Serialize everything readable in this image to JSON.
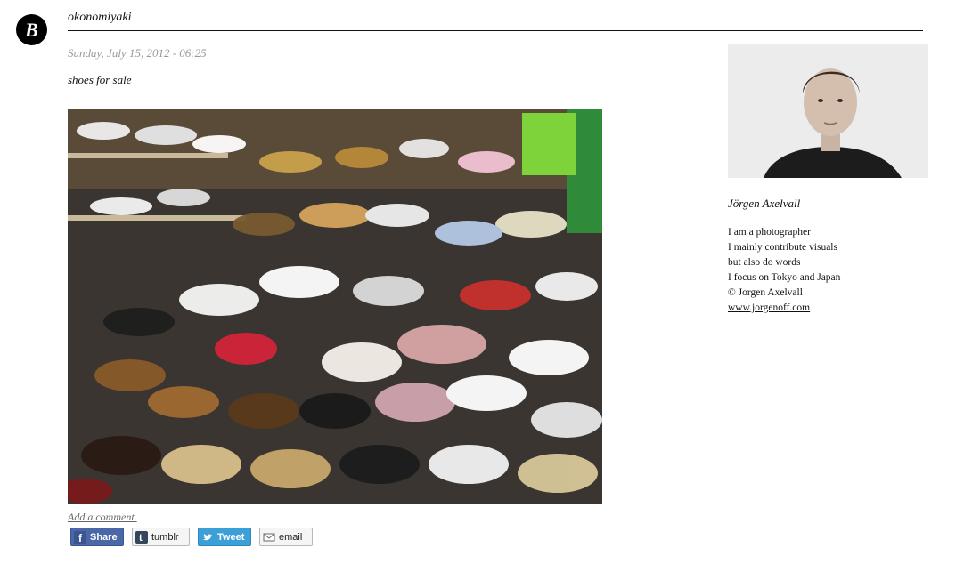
{
  "header": {
    "logo_letter": "B",
    "blog_title": "okonomiyaki"
  },
  "post": {
    "date": "Sunday, July 15, 2012 - 06:25",
    "title": "shoes for sale",
    "add_comment": "Add a comment."
  },
  "share": {
    "facebook_label": "Share",
    "tumblr_label": "tumblr",
    "twitter_label": "Tweet",
    "email_label": "email"
  },
  "sidebar": {
    "author_name": "Jörgen Axelvall",
    "bio_lines": [
      "I am a photographer",
      "I mainly contribute visuals",
      "but also do words",
      "I focus on Tokyo and Japan",
      "© Jorgen Axelvall"
    ],
    "website": "www.jorgenoff.com"
  },
  "colors": {
    "facebook": "#4a67a6",
    "twitter": "#3b9fd8",
    "date_gray": "#9a9a9a"
  }
}
